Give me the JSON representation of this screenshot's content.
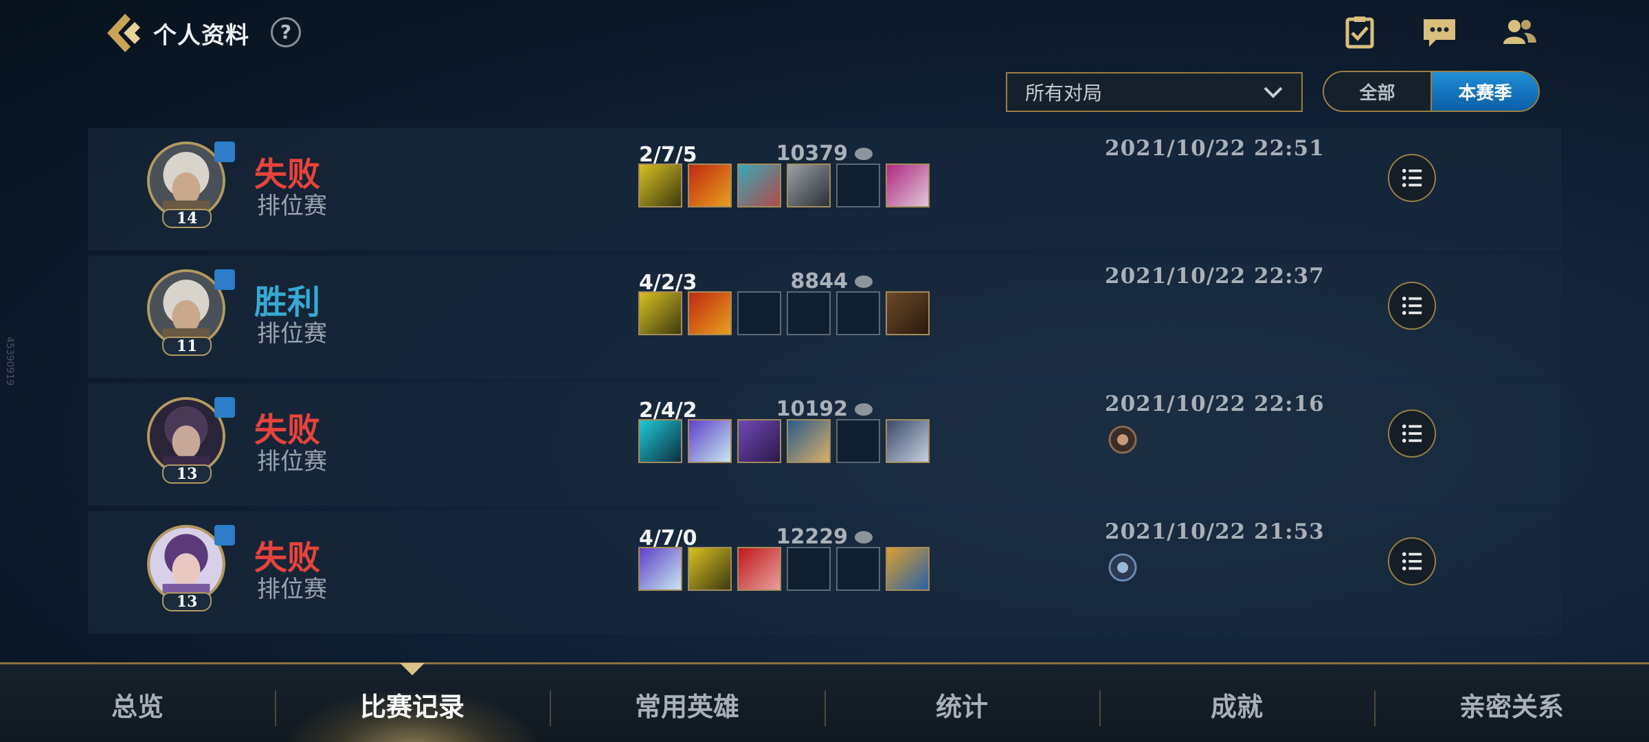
{
  "header": {
    "title": "个人资料",
    "help": "?"
  },
  "top_icons": [
    "task-icon",
    "chat-icon",
    "friends-icon"
  ],
  "filters": {
    "dropdown_value": "所有对局",
    "segment": [
      "全部",
      "本赛季"
    ],
    "active_segment": "本赛季"
  },
  "matches": [
    {
      "result": "失败",
      "mode": "排位赛",
      "level": "14",
      "kda": "2/7/5",
      "gold": "10379",
      "datetime": "2021/10/22 22:51"
    },
    {
      "result": "胜利",
      "mode": "排位赛",
      "level": "11",
      "kda": "4/2/3",
      "gold": "8844",
      "datetime": "2021/10/22 22:37"
    },
    {
      "result": "失败",
      "mode": "排位赛",
      "level": "13",
      "kda": "2/4/2",
      "gold": "10192",
      "datetime": "2021/10/22 22:16"
    },
    {
      "result": "失败",
      "mode": "排位赛",
      "level": "13",
      "kda": "4/7/0",
      "gold": "12229",
      "datetime": "2021/10/22 21:53"
    }
  ],
  "bottom_nav": [
    "总览",
    "比赛记录",
    "常用英雄",
    "统计",
    "成就",
    "亲密关系"
  ],
  "active_tab": "比赛记录",
  "side_text": "45390919",
  "colors": {
    "lose": "#e8433a",
    "win": "#35a9d4",
    "gold_border": "#9a7f45",
    "active_blue": "#1f8ed6"
  }
}
